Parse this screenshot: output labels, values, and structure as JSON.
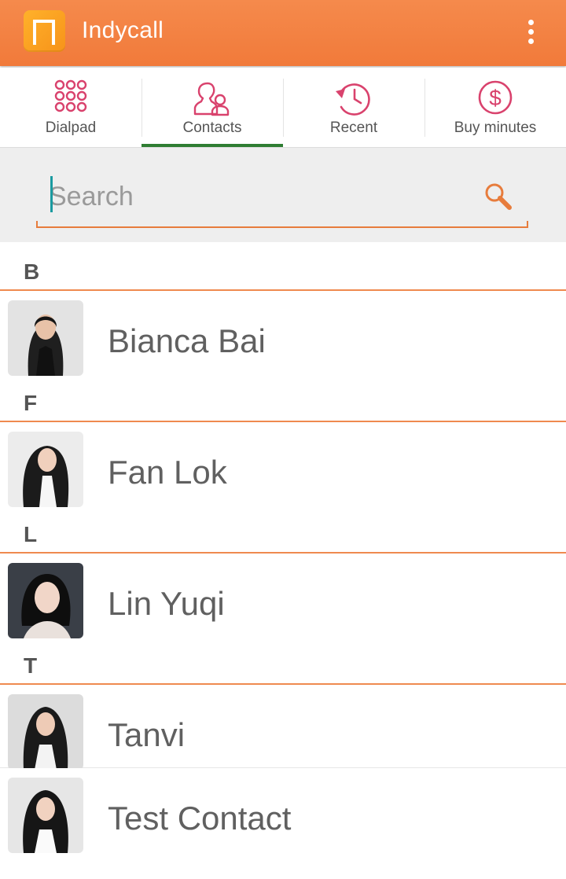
{
  "appbar": {
    "title": "Indycall",
    "logo_letter": "n",
    "accent_color": "#f17a3a"
  },
  "tabs": [
    {
      "label": "Dialpad",
      "icon": "dialpad-icon",
      "active": false
    },
    {
      "label": "Contacts",
      "icon": "contacts-icon",
      "active": true
    },
    {
      "label": "Recent",
      "icon": "history-clock-icon",
      "active": false
    },
    {
      "label": "Buy minutes",
      "icon": "dollar-coin-icon",
      "active": false
    }
  ],
  "search": {
    "placeholder": "Search",
    "value": ""
  },
  "contacts": [
    {
      "letter": "B",
      "names": [
        "Bianca Bai"
      ]
    },
    {
      "letter": "F",
      "names": [
        "Fan Lok"
      ]
    },
    {
      "letter": "L",
      "names": [
        "Lin Yuqi"
      ]
    },
    {
      "letter": "T",
      "names": [
        "Tanvi",
        "Test Contact"
      ]
    }
  ],
  "colors": {
    "active_tab_indicator": "#2e7d32",
    "section_divider": "#ef8a4f",
    "caret": "#1a9aa0"
  }
}
